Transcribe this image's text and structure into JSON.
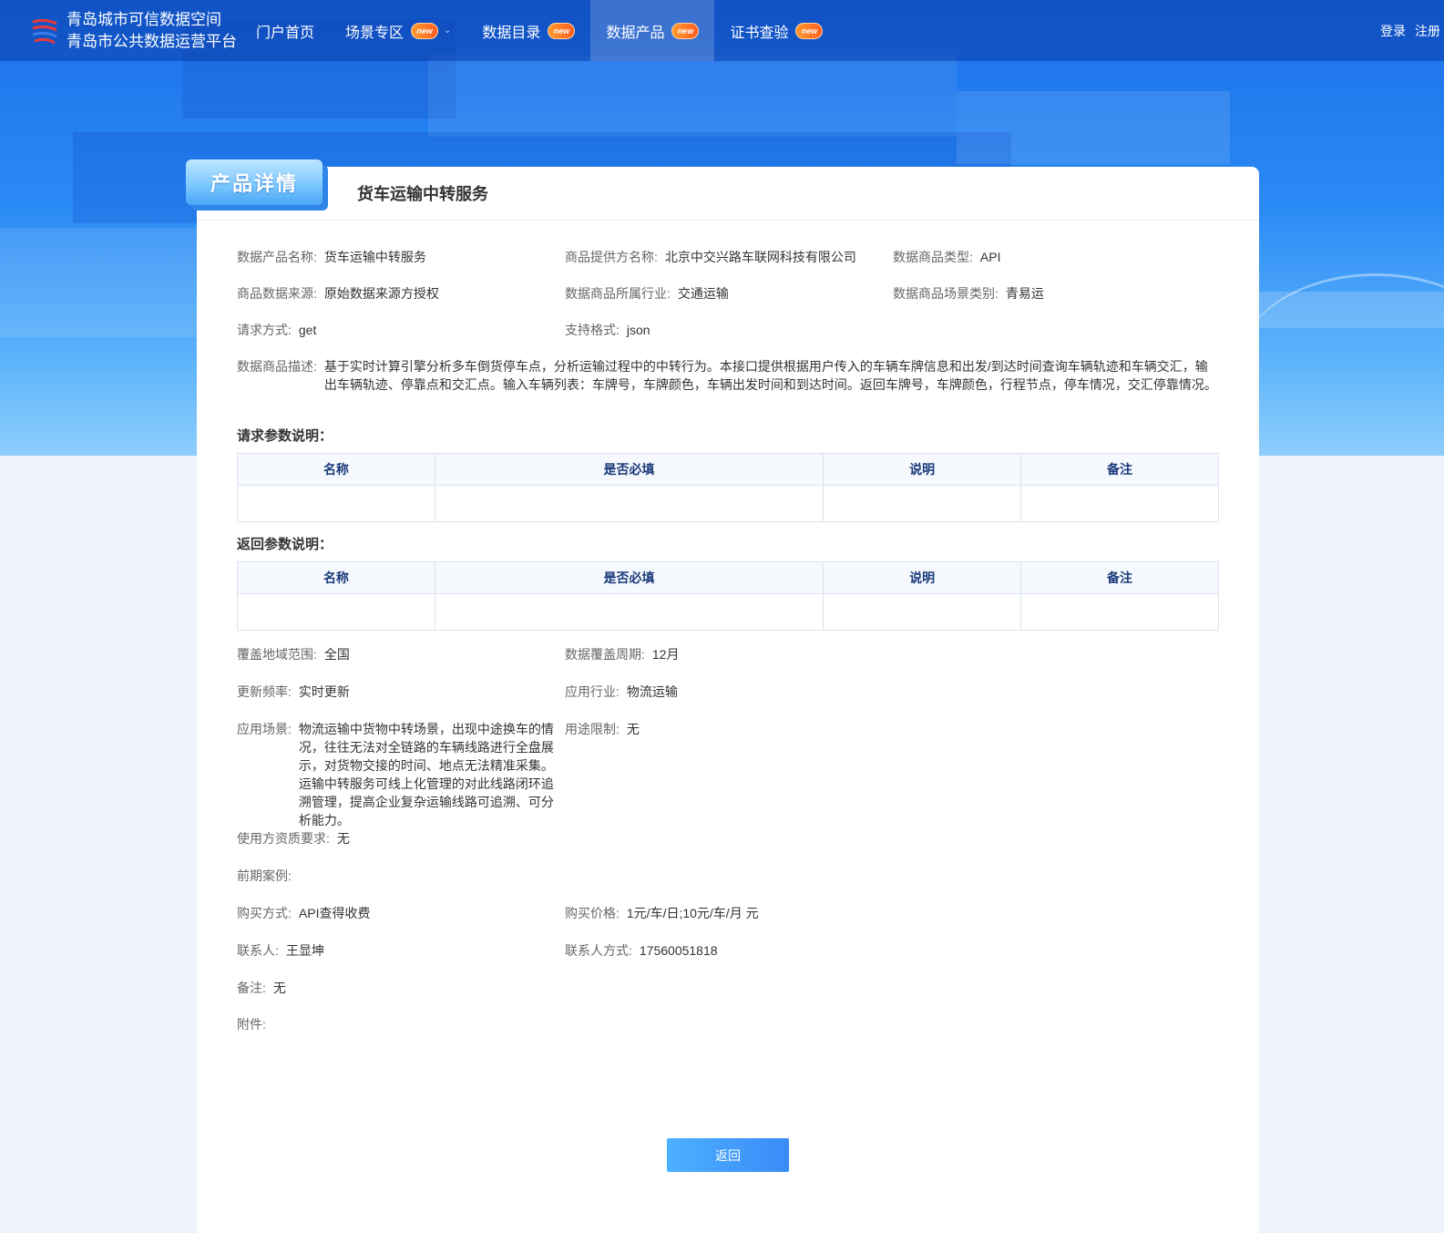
{
  "nav": {
    "brand_line1": "青岛城市可信数据空间",
    "brand_line2": "青岛市公共数据运营平台",
    "items": [
      {
        "label": "门户首页",
        "badge": ""
      },
      {
        "label": "场景专区",
        "badge": "new"
      },
      {
        "label": "数据目录",
        "badge": "new"
      },
      {
        "label": "数据产品",
        "badge": "new"
      },
      {
        "label": "证书查验",
        "badge": "new"
      }
    ],
    "login": "登录",
    "register": "注册"
  },
  "card": {
    "tag": "产品详情",
    "title": "货车运输中转服务"
  },
  "fields": {
    "product_name": {
      "label": "数据产品名称:",
      "value": "货车运输中转服务"
    },
    "provider": {
      "label": "商品提供方名称:",
      "value": "北京中交兴路车联网科技有限公司"
    },
    "type": {
      "label": "数据商品类型:",
      "value": "API"
    },
    "source": {
      "label": "商品数据来源:",
      "value": "原始数据来源方授权"
    },
    "industry": {
      "label": "数据商品所属行业:",
      "value": "交通运输"
    },
    "scene_cat": {
      "label": "数据商品场景类别:",
      "value": "青易运"
    },
    "method": {
      "label": "请求方式:",
      "value": "get"
    },
    "format": {
      "label": "支持格式:",
      "value": "json"
    },
    "desc": {
      "label": "数据商品描述:",
      "value": "基于实时计算引擎分析多车倒货停车点，分析运输过程中的中转行为。本接口提供根据用户传入的车辆车牌信息和出发/到达时间查询车辆轨迹和车辆交汇，输出车辆轨迹、停靠点和交汇点。输入车辆列表：车牌号，车牌颜色，车辆出发时间和到达时间。返回车牌号，车牌颜色，行程节点，停车情况，交汇停靠情况。"
    },
    "coverage": {
      "label": "覆盖地域范围:",
      "value": "全国"
    },
    "period": {
      "label": "数据覆盖周期:",
      "value": "12月"
    },
    "frequency": {
      "label": "更新频率:",
      "value": "实时更新"
    },
    "app_industry": {
      "label": "应用行业:",
      "value": "物流运输"
    },
    "scenario": {
      "label": "应用场景:",
      "value": "物流运输中货物中转场景，出现中途换车的情况，往往无法对全链路的车辆线路进行全盘展示，对货物交接的时间、地点无法精准采集。运输中转服务可线上化管理的对此线路闭环追溯管理，提高企业复杂运输线路可追溯、可分析能力。"
    },
    "restriction": {
      "label": "用途限制:",
      "value": "无"
    },
    "qualification": {
      "label": "使用方资质要求:",
      "value": "无"
    },
    "cases": {
      "label": "前期案例:",
      "value": ""
    },
    "purchase": {
      "label": "购买方式:",
      "value": "API查得收费"
    },
    "price": {
      "label": "购买价格:",
      "value": "1元/车/日;10元/车/月 元"
    },
    "contact": {
      "label": "联系人:",
      "value": "王显坤"
    },
    "phone": {
      "label": "联系人方式:",
      "value": "17560051818"
    },
    "remark": {
      "label": "备注:",
      "value": "无"
    },
    "attachment": {
      "label": "附件:",
      "value": ""
    }
  },
  "request_params": {
    "title": "请求参数说明：",
    "headers": [
      "名称",
      "是否必填",
      "说明",
      "备注"
    ]
  },
  "response_params": {
    "title": "返回参数说明：",
    "headers": [
      "名称",
      "是否必填",
      "说明",
      "备注"
    ]
  },
  "back_button": "返回"
}
